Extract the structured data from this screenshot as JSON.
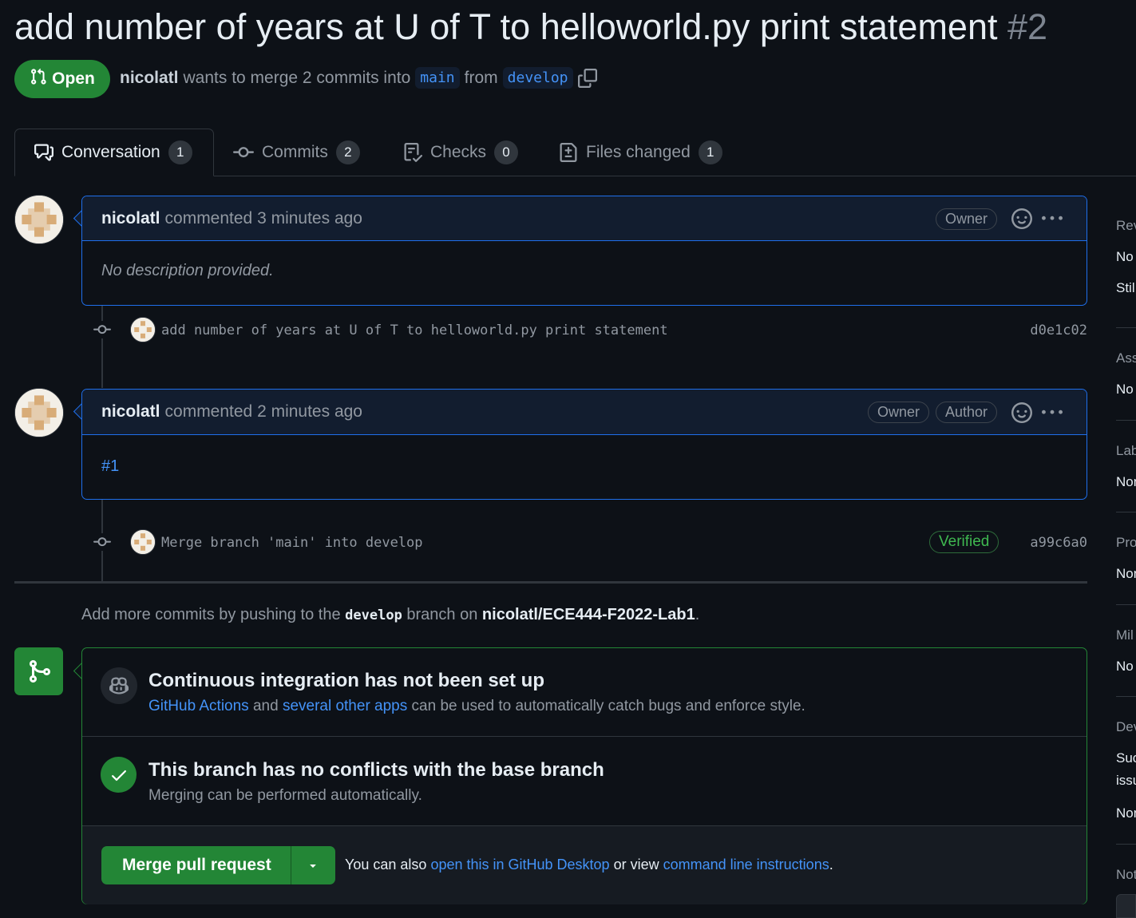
{
  "pr": {
    "title": "add number of years at U of T to helloworld.py print statement",
    "number": "#2",
    "state": "Open",
    "author": "nicolatl",
    "merge_text": "wants to merge 2 commits into",
    "base_branch": "main",
    "from_text": "from",
    "head_branch": "develop"
  },
  "tabs": [
    {
      "label": "Conversation",
      "count": "1"
    },
    {
      "label": "Commits",
      "count": "2"
    },
    {
      "label": "Checks",
      "count": "0"
    },
    {
      "label": "Files changed",
      "count": "1"
    }
  ],
  "comments": [
    {
      "author": "nicolatl",
      "action": "commented 3 minutes ago",
      "labels": [
        "Owner"
      ],
      "body": "No description provided."
    },
    {
      "author": "nicolatl",
      "action": "commented 2 minutes ago",
      "labels": [
        "Owner",
        "Author"
      ],
      "body": "#1"
    }
  ],
  "commits": [
    {
      "message": "add number of years at U of T to helloworld.py print statement",
      "sha": "d0e1c02",
      "verified": ""
    },
    {
      "message": "Merge branch 'main' into develop",
      "sha": "a99c6a0",
      "verified": "Verified"
    }
  ],
  "push_hint": {
    "prefix": "Add more commits by pushing to the",
    "branch": "develop",
    "middle": "branch on",
    "repo": "nicolatl/ECE444-F2022-Lab1",
    "suffix": "."
  },
  "ci": {
    "title": "Continuous integration has not been set up",
    "link1": "GitHub Actions",
    "and": "and",
    "link2": "several other apps",
    "rest": "can be used to automatically catch bugs and enforce style."
  },
  "conflicts": {
    "title": "This branch has no conflicts with the base branch",
    "subtitle": "Merging can be performed automatically."
  },
  "merge": {
    "button": "Merge pull request",
    "hint_prefix": "You can also",
    "link1": "open this in GitHub Desktop",
    "middle": "or view",
    "link2": "command line instructions",
    "suffix": "."
  },
  "sidebar": {
    "reviewers": "Rev",
    "reviewers_v1": "No",
    "reviewers_v2": "Stil",
    "assignees": "Ass",
    "assignees_v": "No",
    "labels": "Lab",
    "labels_v": "Non",
    "projects": "Pro",
    "projects_v": "Non",
    "milestone": "Mil",
    "milestone_v": "No",
    "development": "Dev",
    "development_v1": "Suc",
    "development_v2": "issu",
    "development_v3": "Non",
    "notifications": "Not"
  },
  "colors": {
    "background": "#0d1117",
    "open_green": "#238636",
    "link_blue": "#4493f8",
    "verified_green": "#3fb950"
  }
}
